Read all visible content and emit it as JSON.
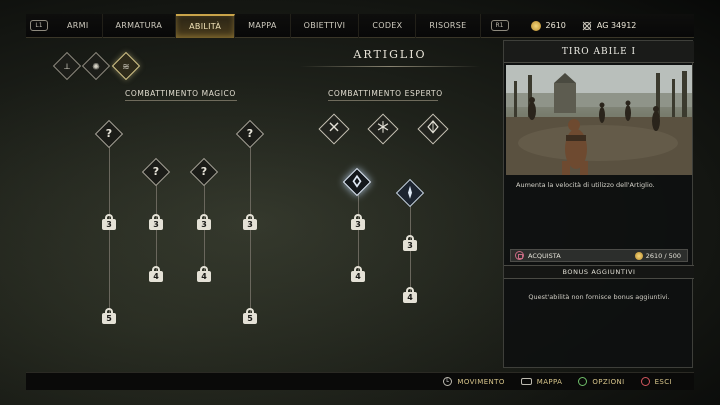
{
  "top_bar": {
    "left_badge": "L1",
    "right_badge": "R1",
    "tabs": [
      {
        "label": "ARMI"
      },
      {
        "label": "ARMATURA"
      },
      {
        "label": "ABILITÀ",
        "active": true
      },
      {
        "label": "MAPPA"
      },
      {
        "label": "OBIETTIVI"
      },
      {
        "label": "CODEX"
      },
      {
        "label": "RISORSE"
      }
    ],
    "hacksilver": "2610",
    "xp": "AG 34912"
  },
  "section": {
    "title": "ARTIGLIO"
  },
  "category_icons": [
    {
      "name": "axe-icon",
      "glyph": "⟂",
      "active": false
    },
    {
      "name": "emblem-icon",
      "glyph": "✺",
      "active": false
    },
    {
      "name": "claw-icon",
      "glyph": "≋",
      "active": true
    }
  ],
  "groups": {
    "magic": {
      "label": "COMBATTIMENTO MAGICO"
    },
    "expert": {
      "label": "COMBATTIMENTO ESPERTO"
    }
  },
  "nodes": {
    "unknown_glyph": "?",
    "magic_lock_levels": [
      "3",
      "5",
      "3",
      "4",
      "3",
      "4",
      "3",
      "5"
    ],
    "expert_lock_levels": [
      "3",
      "4",
      "3",
      "4"
    ],
    "expert_starters": [
      "crossed-tools-icon",
      "cross-swords-icon",
      "diamond-rune-icon"
    ]
  },
  "panel": {
    "title": "TIRO ABILE I",
    "description": "Aumenta la velocità di utilizzo dell'Artiglio.",
    "buy_label": "ACQUISTA",
    "buy_cost": "2610 / 500",
    "bonus_title": "BONUS AGGIUNTIVI",
    "bonus_text": "Quest'abilità non fornisce bonus aggiuntivi."
  },
  "bottom_hints": [
    {
      "label": "MOVIMENTO",
      "icon": "left-stick-icon"
    },
    {
      "label": "MAPPA",
      "icon": "touchpad-icon"
    },
    {
      "label": "OPZIONI",
      "icon": "options-icon"
    },
    {
      "label": "ESCI",
      "icon": "circle-button-icon"
    }
  ],
  "colors": {
    "accent_gold": "#c9a44a",
    "hint_gold": "#d6c48a",
    "node_border": "#a8a499",
    "highlight_blue": "#e8f2ff"
  }
}
